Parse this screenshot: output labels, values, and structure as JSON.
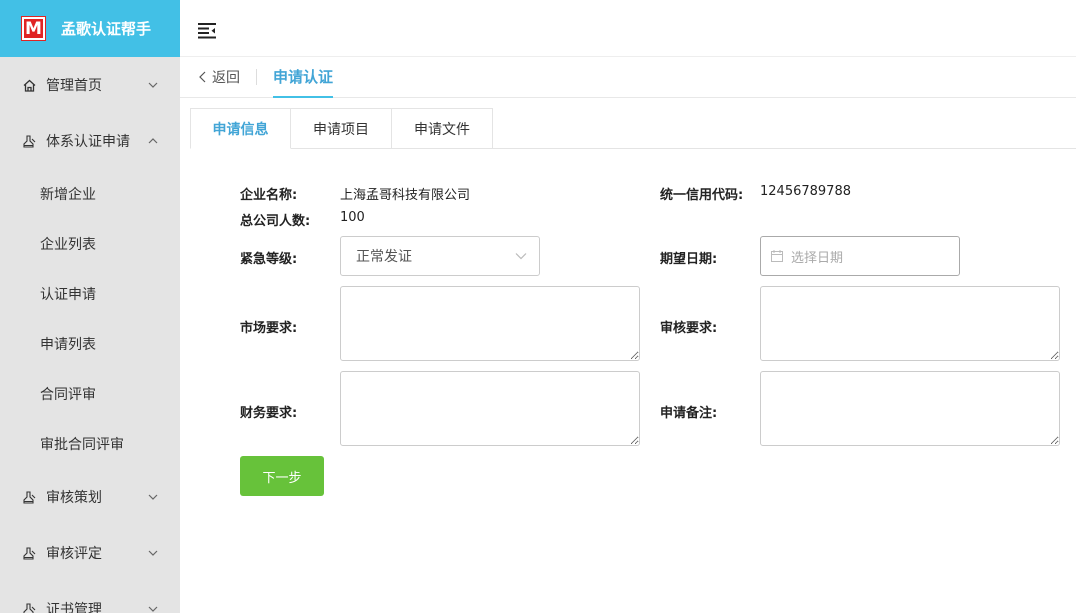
{
  "brand": {
    "logo_letter": "M",
    "title": "孟歌认证帮手"
  },
  "sidebar": {
    "items": [
      {
        "label": "管理首页",
        "icon": "home-icon"
      },
      {
        "label": "体系认证申请",
        "icon": "stamp-icon"
      },
      {
        "label": "审核策划",
        "icon": "stamp-icon"
      },
      {
        "label": "审核评定",
        "icon": "stamp-icon"
      },
      {
        "label": "证书管理",
        "icon": "stamp-icon"
      }
    ],
    "sub_items": [
      "新增企业",
      "企业列表",
      "认证申请",
      "申请列表",
      "合同评审",
      "审批合同评审"
    ]
  },
  "breadcrumb": {
    "back": "返回",
    "current": "申请认证"
  },
  "tabs": [
    "申请信息",
    "申请项目",
    "申请文件"
  ],
  "form": {
    "company_name_label": "企业名称:",
    "company_name": "上海孟哥科技有限公司",
    "credit_code_label": "统一信用代码:",
    "credit_code": "12456789788",
    "headcount_label": "总公司人数:",
    "headcount": "100",
    "urgency_label": "紧急等级:",
    "urgency_value": "正常发证",
    "expected_date_label": "期望日期:",
    "expected_date_placeholder": "选择日期",
    "market_req_label": "市场要求:",
    "audit_req_label": "审核要求:",
    "finance_req_label": "财务要求:",
    "remarks_label": "申请备注:",
    "next_button": "下一步"
  },
  "colors": {
    "brand": "#42c0e6",
    "accent": "#42a5d6",
    "button": "#67c23a",
    "logo": "#e02424"
  }
}
